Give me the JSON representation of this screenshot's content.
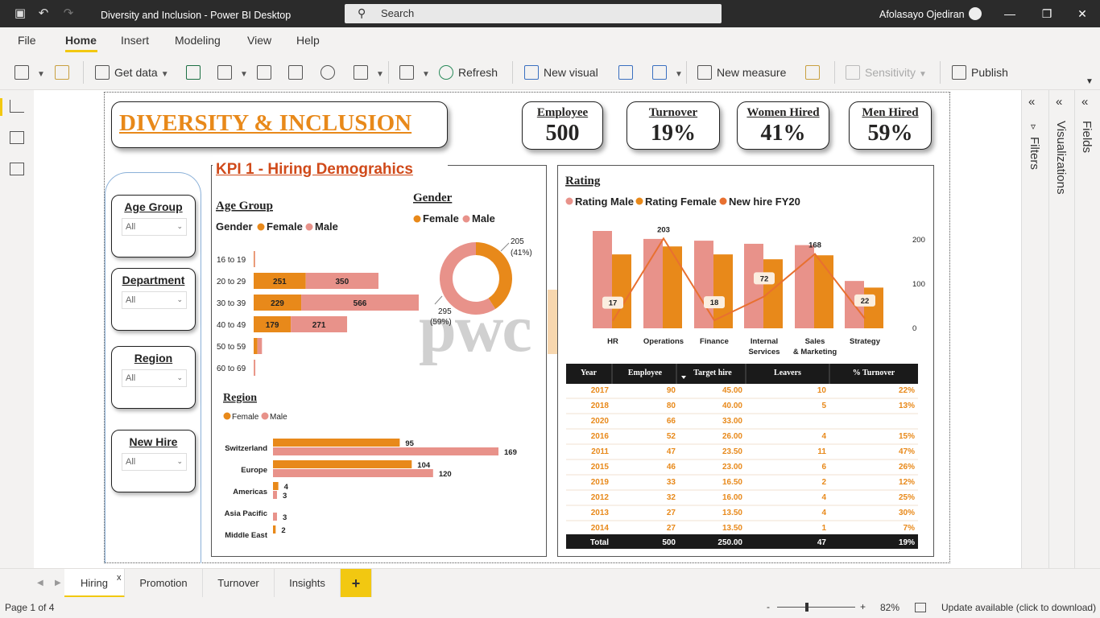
{
  "app": {
    "title": "Diversity and Inclusion - Power BI Desktop",
    "search_placeholder": "Search",
    "user": "Afolasayo Ojediran"
  },
  "menu": [
    "File",
    "Home",
    "Insert",
    "Modeling",
    "View",
    "Help"
  ],
  "ribbon": {
    "get_data": "Get data",
    "refresh": "Refresh",
    "new_visual": "New visual",
    "new_measure": "New measure",
    "sensitivity": "Sensitivity",
    "publish": "Publish"
  },
  "panes": {
    "filters": "Filters",
    "visualizations": "Visualizations",
    "fields": "Fields"
  },
  "report": {
    "title": "DIVERSITY & INCLUSION",
    "kpis": [
      {
        "label": "Employee",
        "value": "500"
      },
      {
        "label": "Turnover",
        "value": "19%"
      },
      {
        "label": "Women Hired",
        "value": "41%"
      },
      {
        "label": "Men Hired",
        "value": "59%"
      }
    ],
    "slicers": [
      {
        "title": "Age Group",
        "value": "All"
      },
      {
        "title": "Department",
        "value": "All"
      },
      {
        "title": "Region",
        "value": "All"
      },
      {
        "title": "New Hire",
        "value": "All"
      }
    ],
    "kpi1_title": "KPI 1 - Hiring Demograhics",
    "watermark": "pwc",
    "colors": {
      "female": "#e8891a",
      "male": "#e8928a",
      "line": "#e87030",
      "dark": "#1a1a1a",
      "title": "#e8891a",
      "kpi1": "#d04a1a"
    }
  },
  "chart_data": [
    {
      "type": "bar",
      "title": "Age Group",
      "legend_title": "Gender",
      "orientation": "horizontal-stacked",
      "categories": [
        "16 to 19",
        "20 to 29",
        "30 to 39",
        "40 to 49",
        "50 to 59",
        "60 to 69"
      ],
      "series": [
        {
          "name": "Female",
          "values": [
            2,
            251,
            229,
            179,
            18,
            1
          ],
          "labels": [
            "",
            "251",
            "229",
            "179",
            "",
            ""
          ]
        },
        {
          "name": "Male",
          "values": [
            5,
            350,
            566,
            271,
            22,
            7
          ],
          "labels": [
            "",
            "350",
            "566",
            "271",
            "",
            ""
          ]
        }
      ]
    },
    {
      "type": "pie",
      "title": "Gender",
      "donut": true,
      "slices": [
        {
          "name": "Female",
          "value": 205,
          "label": "205",
          "pct": "(41%)"
        },
        {
          "name": "Male",
          "value": 295,
          "label": "295",
          "pct": "(59%)"
        }
      ]
    },
    {
      "type": "bar",
      "title": "Region",
      "orientation": "horizontal-clustered",
      "categories": [
        "Switzerland",
        "Europe",
        "Americas",
        "Asia Pacific",
        "Middle East"
      ],
      "series": [
        {
          "name": "Female",
          "values": [
            95,
            104,
            4,
            0,
            2
          ],
          "labels": [
            "95",
            "104",
            "4",
            "",
            "2"
          ]
        },
        {
          "name": "Male",
          "values": [
            169,
            120,
            3,
            3,
            0
          ],
          "labels": [
            "169",
            "120",
            "3",
            "3",
            ""
          ]
        }
      ]
    },
    {
      "type": "bar",
      "title": "Rating",
      "combo": "clustered column + line",
      "categories": [
        "HR",
        "Operations",
        "Finance",
        "Internal Services",
        "Sales & Marketing",
        "Strategy"
      ],
      "y_axis_ticks": [
        "200",
        "100",
        "0"
      ],
      "ylim": [
        0,
        240
      ],
      "series": [
        {
          "name": "Rating Male",
          "values": [
            220,
            202,
            198,
            191,
            188,
            107
          ]
        },
        {
          "name": "Rating Female",
          "values": [
            167,
            185,
            167,
            156,
            165,
            92
          ]
        },
        {
          "name": "New hire FY20",
          "kind": "line",
          "values": [
            17,
            203,
            18,
            72,
            168,
            22
          ],
          "labels": [
            "17",
            "203",
            "18",
            "72",
            "168",
            "22"
          ]
        }
      ]
    },
    {
      "type": "table",
      "columns": [
        "Year",
        "Employee",
        "Target hire",
        "Leavers",
        "% Turnover"
      ],
      "rows": [
        [
          "2017",
          "90",
          "45.00",
          "10",
          "22%"
        ],
        [
          "2018",
          "80",
          "40.00",
          "5",
          "13%"
        ],
        [
          "2020",
          "66",
          "33.00",
          "",
          ""
        ],
        [
          "2016",
          "52",
          "26.00",
          "4",
          "15%"
        ],
        [
          "2011",
          "47",
          "23.50",
          "11",
          "47%"
        ],
        [
          "2015",
          "46",
          "23.00",
          "6",
          "26%"
        ],
        [
          "2019",
          "33",
          "16.50",
          "2",
          "12%"
        ],
        [
          "2012",
          "32",
          "16.00",
          "4",
          "25%"
        ],
        [
          "2013",
          "27",
          "13.50",
          "4",
          "30%"
        ],
        [
          "2014",
          "27",
          "13.50",
          "1",
          "7%"
        ]
      ],
      "total": [
        "Total",
        "500",
        "250.00",
        "47",
        "19%"
      ]
    }
  ],
  "page_tabs": [
    "Hiring",
    "Promotion",
    "Turnover",
    "Insights"
  ],
  "add_page_label": "+",
  "tab_close_label": "x",
  "status": {
    "page": "Page 1 of 4",
    "zoom": "82%",
    "update": "Update available (click to download)",
    "zoom_minus": "-",
    "zoom_plus": "+"
  }
}
